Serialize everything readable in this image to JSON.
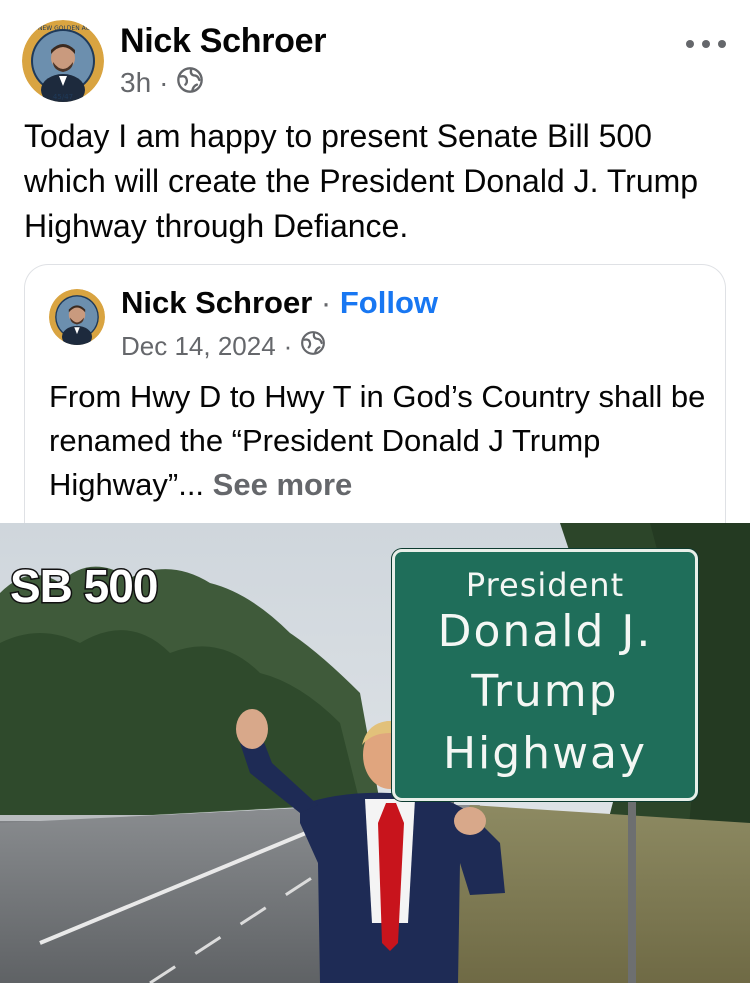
{
  "post": {
    "author": "Nick Schroer",
    "time": "3h",
    "separator": "·",
    "audience_icon": "globe-icon",
    "more_icon": "more-options-icon",
    "text": "Today I am happy to present Senate Bill 500 which will create the President Donald J. Trump Highway through Defiance."
  },
  "shared": {
    "author": "Nick Schroer",
    "separator": "·",
    "follow_label": "Follow",
    "date": "Dec 14, 2024",
    "audience_icon": "globe-icon",
    "text": "From Hwy D to Hwy T in God’s Country shall be renamed the “President Donald J Trump Highway”...",
    "see_more": "See more"
  },
  "photo": {
    "overlay_label": "SB 500",
    "sign": {
      "line1": "President",
      "line2": "Donald J.",
      "line3": "Trump",
      "line4": "Highway"
    }
  },
  "colors": {
    "link_blue": "#1877f2",
    "secondary_text": "#65676b",
    "sign_green": "#1f6e5a",
    "badge_gold": "#d9a441"
  }
}
